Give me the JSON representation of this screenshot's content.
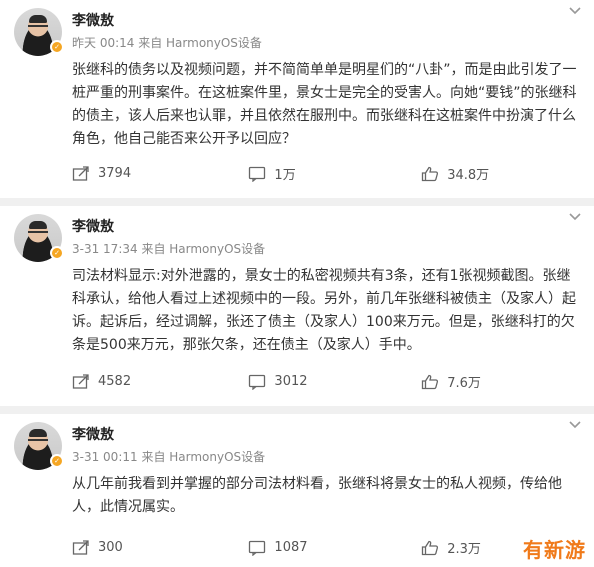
{
  "posts": [
    {
      "author": "李微敖",
      "meta": "昨天 00:14 来自 HarmonyOS设备",
      "content": "张继科的债务以及视频问题，并不简简单单是明星们的“八卦”，而是由此引发了一桩严重的刑事案件。在这桩案件里，景女士是完全的受害人。向她“要钱”的张继科的债主，该人后来也认罪，并且依然在服刑中。而张继科在这桩案件中扮演了什么角色，他自己能否来公开予以回应？",
      "reposts": "3794",
      "comments": "1万",
      "likes": "34.8万"
    },
    {
      "author": "李微敖",
      "meta": "3-31 17:34 来自 HarmonyOS设备",
      "content": "司法材料显示:对外泄露的，景女士的私密视频共有3条，还有1张视频截图。张继科承认，给他人看过上述视频中的一段。另外，前几年张继科被债主（及家人）起诉。起诉后，经过调解，张还了债主（及家人）100来万元。但是，张继科打的欠条是500来万元，那张欠条，还在债主（及家人）手中。",
      "reposts": "4582",
      "comments": "3012",
      "likes": "7.6万"
    },
    {
      "author": "李微敖",
      "meta": "3-31 00:11 来自 HarmonyOS设备",
      "content": "从几年前我看到并掌握的部分司法材料看，张继科将景女士的私人视频，传给他人，此情况属实。",
      "reposts": "300",
      "comments": "1087",
      "likes": "2.3万"
    }
  ],
  "icons": {
    "more": "chevron-down-icon",
    "repost": "repost-icon",
    "comment": "comment-icon",
    "like": "thumbs-up-icon",
    "verified": "verified-badge-icon"
  },
  "watermark": "有新游",
  "colors": {
    "background": "#f0f0f0",
    "card": "#ffffff",
    "meta_text": "#888888",
    "badge": "#f5a623",
    "watermark": "#f07a1a"
  }
}
